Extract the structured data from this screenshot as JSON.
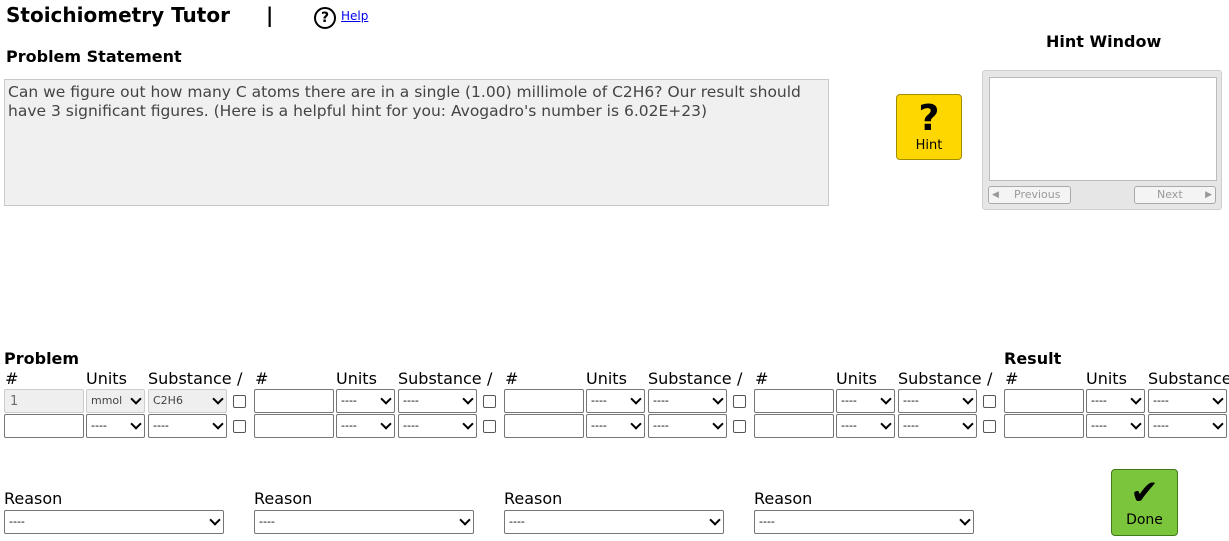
{
  "app_title": "Stoichiometry Tutor",
  "title_separator": "|",
  "help_icon_glyph": "?",
  "help_label": "Help",
  "problem_statement_label": "Problem Statement",
  "problem_text": "Can we figure out how many C atoms there are in a single (1.00) millimole of C2H6? Our result should have 3 significant figures. (Here is a helpful hint for you: Avogadro's number is 6.02E+23)",
  "hint": {
    "glyph": "?",
    "label": "Hint"
  },
  "hint_window": {
    "title": "Hint Window",
    "prev_label": "Previous",
    "next_label": "Next"
  },
  "table": {
    "problem_label": "Problem",
    "result_label": "Result",
    "col_hash": "#",
    "col_units": "Units",
    "col_substance": "Substance",
    "divider": "/",
    "empty_option": "----",
    "given": {
      "value": "1",
      "units": "mmol",
      "substance": "C2H6"
    }
  },
  "reason_label": "Reason",
  "done": {
    "glyph": "✔",
    "label": "Done"
  }
}
